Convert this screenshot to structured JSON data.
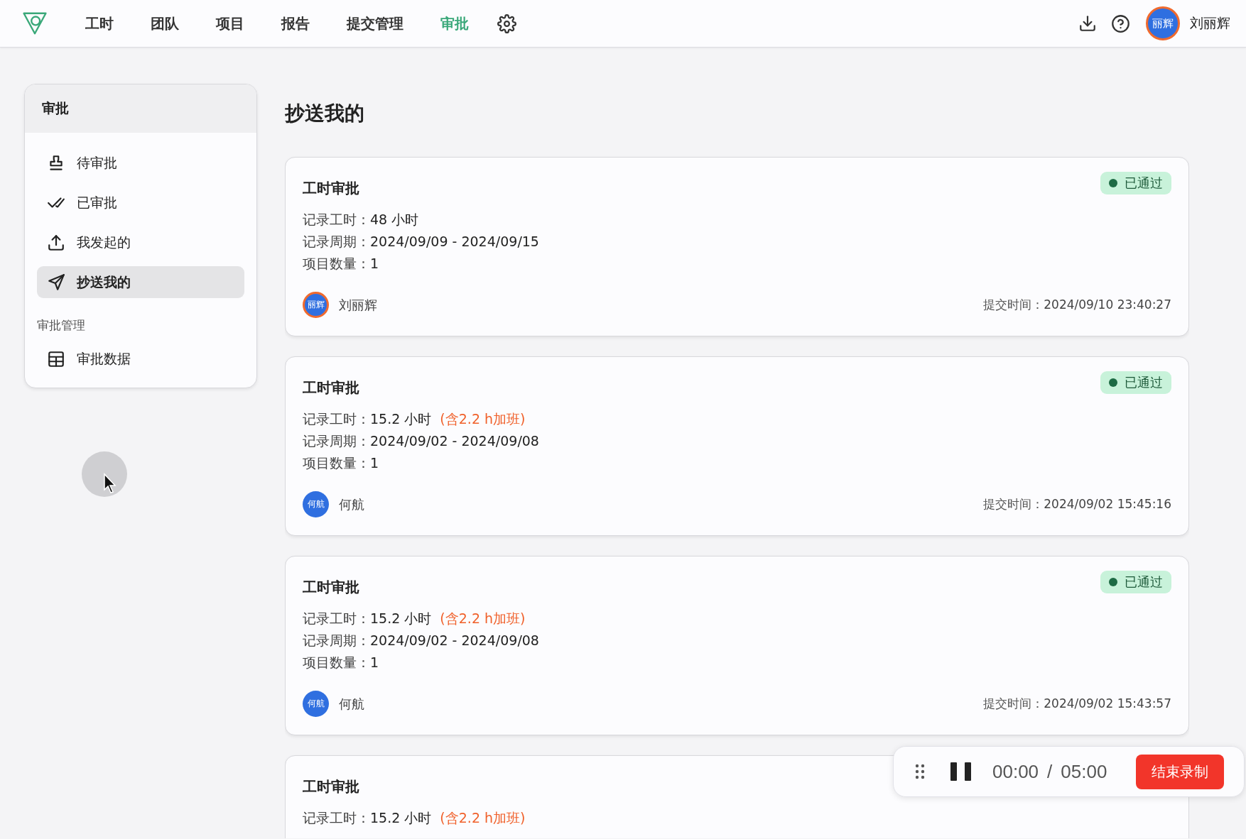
{
  "nav": {
    "items": [
      {
        "label": "工时",
        "selected": false
      },
      {
        "label": "团队",
        "selected": false
      },
      {
        "label": "项目",
        "selected": false
      },
      {
        "label": "报告",
        "selected": false
      },
      {
        "label": "提交管理",
        "selected": false
      },
      {
        "label": "审批",
        "selected": true
      }
    ]
  },
  "user": {
    "avatar_text": "丽辉",
    "name": "刘丽辉"
  },
  "sidebar": {
    "title": "审批",
    "groups": [
      {
        "items": [
          {
            "label": "待审批",
            "selected": false
          },
          {
            "label": "已审批",
            "selected": false
          },
          {
            "label": "我发起的",
            "selected": false
          },
          {
            "label": "抄送我的",
            "selected": true
          }
        ]
      },
      {
        "heading": "审批管理",
        "items": [
          {
            "label": "审批数据",
            "selected": false
          }
        ]
      }
    ]
  },
  "page_title": "抄送我的",
  "cards": [
    {
      "title": "工时审批",
      "status": "已通过",
      "fields": [
        {
          "label": "记录工时：",
          "value": "48 小时"
        },
        {
          "label": "记录周期：",
          "value": "2024/09/09 - 2024/09/15"
        },
        {
          "label": "项目数量：",
          "value": "1"
        }
      ],
      "submitter": {
        "avatar_text": "丽辉",
        "kind": "badge",
        "name": "刘丽辉"
      },
      "time_label": "提交时间：",
      "time": "2024/09/10 23:40:27"
    },
    {
      "title": "工时审批",
      "status": "已通过",
      "fields": [
        {
          "label": "记录工时：",
          "value": "15.2 小时",
          "note": "(含2.2 h加班)"
        },
        {
          "label": "记录周期：",
          "value": "2024/09/02 - 2024/09/08"
        },
        {
          "label": "项目数量：",
          "value": "1"
        }
      ],
      "submitter": {
        "avatar_text": "何航",
        "kind": "plain",
        "name": "何航"
      },
      "time_label": "提交时间：",
      "time": "2024/09/02 15:45:16"
    },
    {
      "title": "工时审批",
      "status": "已通过",
      "fields": [
        {
          "label": "记录工时：",
          "value": "15.2 小时",
          "note": "(含2.2 h加班)"
        },
        {
          "label": "记录周期：",
          "value": "2024/09/02 - 2024/09/08"
        },
        {
          "label": "项目数量：",
          "value": "1"
        }
      ],
      "submitter": {
        "avatar_text": "何航",
        "kind": "plain",
        "name": "何航"
      },
      "time_label": "提交时间：",
      "time": "2024/09/02 15:43:57"
    },
    {
      "title": "工时审批",
      "fields": [
        {
          "label": "记录工时：",
          "value": "15.2 小时",
          "note": "(含2.2 h加班)"
        }
      ]
    }
  ],
  "recorder": {
    "elapsed": "00:00",
    "separator": "/",
    "limit": "05:00",
    "stop_label": "结束录制"
  }
}
